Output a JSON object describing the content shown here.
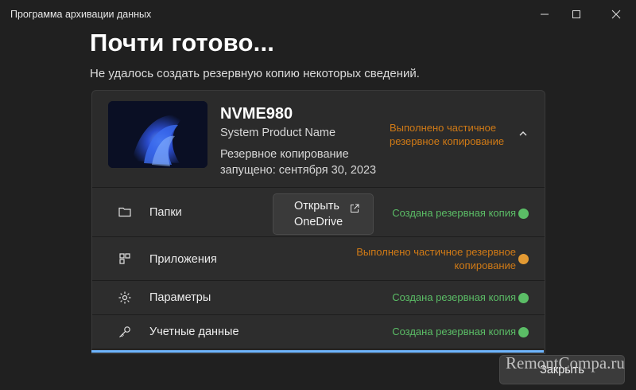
{
  "window": {
    "title": "Программа архивации данных",
    "heading": "Почти готово...",
    "subheading": "Не удалось создать резервную копию некоторых сведений."
  },
  "device": {
    "name": "NVME980",
    "model": "System Product Name",
    "started": "Резервное копирование запущено: сентября 30, 2023",
    "status": "Выполнено частичное резервное копирование"
  },
  "rows": [
    {
      "label": "Папки",
      "status": "Создана резервная копия",
      "state": "success",
      "icon": "folder-icon",
      "button": "Открыть OneDrive"
    },
    {
      "label": "Приложения",
      "status": "Выполнено частичное резервное копирование",
      "state": "partial",
      "icon": "apps-icon"
    },
    {
      "label": "Параметры",
      "status": "Создана резервная копия",
      "state": "success",
      "icon": "gear-icon"
    },
    {
      "label": "Учетные данные",
      "status": "Создана резервная копия",
      "state": "success",
      "icon": "key-icon"
    }
  ],
  "footer": {
    "close_label": "Закрыть",
    "watermark": "RemontCompa.ru"
  },
  "colors": {
    "success": "#5bbd66",
    "partial": "#d07a16",
    "accent": "#6fb6ff"
  }
}
